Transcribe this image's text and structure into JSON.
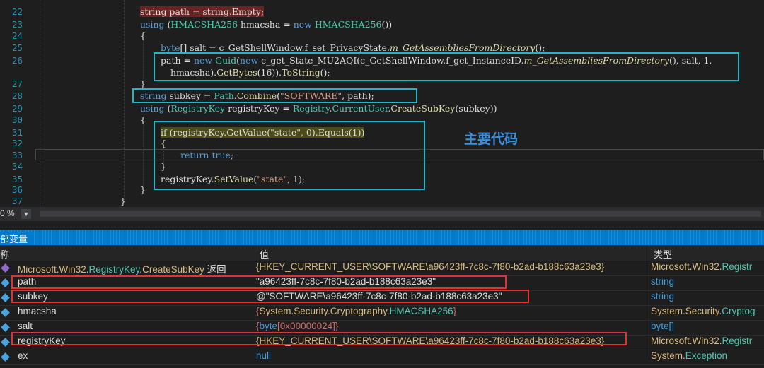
{
  "editor": {
    "line_numbers": [
      "22",
      "23",
      "24",
      "25",
      "26",
      "27",
      "28",
      "29",
      "30",
      "31",
      "32",
      "33",
      "34",
      "35",
      "36",
      "37"
    ],
    "code": {
      "l22": "string path = string.Empty;",
      "l23_a": "using",
      "l23_b": " (",
      "l23_c": "HMACSHA256",
      "l23_d": " hmacsha = ",
      "l23_e": "new",
      "l23_f": " ",
      "l23_g": "HMACSHA256",
      "l23_h": "())",
      "l24": "{",
      "l25_a": "byte",
      "l25_b": "[] salt = c_GetShellWindow.f_set_PrivacyState.",
      "l25_c": "m_GetAssembliesFromDirectory",
      "l25_d": "();",
      "l26_a": "path = ",
      "l26_b": "new",
      "l26_c": " ",
      "l26_d": "Guid",
      "l26_e": "(",
      "l26_f": "new",
      "l26_g": " c_get_State_MU2AQI(c_GetShellWindow.f_get_InstanceID.",
      "l26_h": "m_GetAssembliesFromDirectory",
      "l26_i": "(), salt, 1,",
      "l26b_a": "hmacsha).",
      "l26b_b": "GetBytes",
      "l26b_c": "(16)).",
      "l26b_d": "ToString",
      "l26b_e": "();",
      "l27": "}",
      "l28_a": "string",
      "l28_b": " subkey = ",
      "l28_c": "Path",
      "l28_d": ".",
      "l28_e": "Combine",
      "l28_f": "(",
      "l28_g": "\"SOFTWARE\"",
      "l28_h": ", path);",
      "l29_a": "using",
      "l29_b": " (",
      "l29_c": "RegistryKey",
      "l29_d": " registryKey = ",
      "l29_e": "Registry",
      "l29_f": ".",
      "l29_g": "CurrentUser",
      "l29_h": ".",
      "l29_i": "CreateSubKey",
      "l29_j": "(subkey))",
      "l30": "{",
      "l31": "if (registryKey.GetValue(\"state\", 0).Equals(1))",
      "l32": "{",
      "l33_a": "return",
      "l33_b": " ",
      "l33_c": "true",
      "l33_d": ";",
      "l34": "}",
      "l35_a": "registryKey.",
      "l35_b": "SetValue",
      "l35_c": "(",
      "l35_d": "\"state\"",
      "l35_e": ", 1);",
      "l36": "}",
      "l37": "}"
    },
    "annotation": "主要代码",
    "zoom": "0 %"
  },
  "locals": {
    "title": "部变量",
    "headers": {
      "name": "称",
      "value": "值",
      "type": "类型"
    },
    "rows": [
      {
        "name_a": "Microsoft.Win32.",
        "name_b": "RegistryKey",
        "name_c": ".",
        "name_d": "CreateSubKey",
        "name_e": " 返回",
        "value": "{HKEY_CURRENT_USER\\SOFTWARE\\a96423ff-7c8c-7f80-b2ad-b188c63a23e3}",
        "type_a": "Microsoft.Win32.",
        "type_b": "Registr"
      },
      {
        "name": "path",
        "value": "\"a96423ff-7c8c-7f80-b2ad-b188c63a23e3\"",
        "type": "string"
      },
      {
        "name": "subkey",
        "value": "@\"SOFTWARE\\a96423ff-7c8c-7f80-b2ad-b188c63a23e3\"",
        "type": "string"
      },
      {
        "name": "hmacsha",
        "value_a": "{",
        "value_b": "System.Security.Cryptography.",
        "value_c": "HMACSHA256",
        "value_d": "}",
        "type_a": "System.Security.",
        "type_b": "Cryptog"
      },
      {
        "name": "salt",
        "value_a": "{",
        "value_b": "byte",
        "value_c": "[0x00000024]",
        "value_d": "}",
        "type": "byte[]"
      },
      {
        "name": "registryKey",
        "value": "{HKEY_CURRENT_USER\\SOFTWARE\\a96423ff-7c8c-7f80-b2ad-b188c63a23e3}",
        "type_a": "Microsoft.Win32.",
        "type_b": "Registr"
      },
      {
        "name": "ex",
        "value": "null",
        "type_a": "System.",
        "type_b": "Exception"
      }
    ]
  },
  "colors": {
    "box_cyan": "#1fb6c9",
    "box_red": "#e13333",
    "accent": "#007acc"
  }
}
